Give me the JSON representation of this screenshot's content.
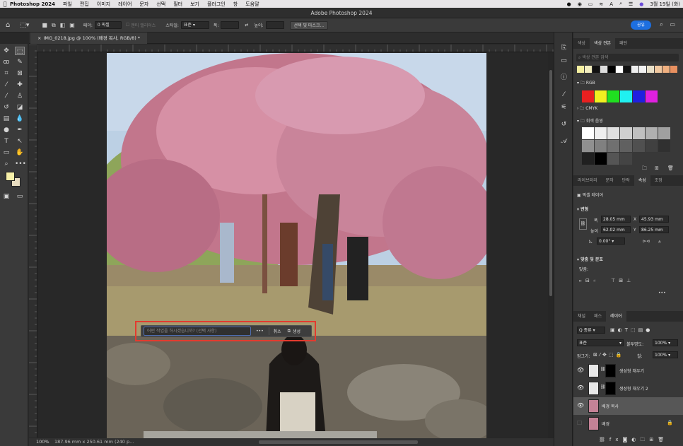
{
  "menubar": {
    "apple": "",
    "app": "Photoshop 2024",
    "items": [
      "파일",
      "편집",
      "이미지",
      "레이어",
      "문자",
      "선택",
      "필터",
      "보기",
      "플러그인",
      "창",
      "도움말"
    ],
    "date": "3월 19일 (화)"
  },
  "window": {
    "title": "Adobe Photoshop 2024"
  },
  "options": {
    "feather_label": "페더:",
    "feather_value": "0 픽셀",
    "antialias": "앤티 앨리어스",
    "style_label": "스타일:",
    "style_value": "표준",
    "width_label": "폭:",
    "height_label": "높이:",
    "select_mask": "선택 및 마스크...",
    "share": "공유"
  },
  "document": {
    "tab": "IMG_0218.jpg @ 100% (배경 복사, RGB/8) *"
  },
  "status": {
    "zoom": "100%",
    "info": "187.96 mm x 250.61 mm (240 p..."
  },
  "generative": {
    "placeholder": "어떤 작업을 하시겠습니까? (선택 사항)",
    "more": "•••",
    "cancel": "취소",
    "generate": "생성"
  },
  "swatches": {
    "tabs": [
      "색상",
      "색상 견본",
      "패턴"
    ],
    "search_placeholder": "색상 견본 검색",
    "recent": [
      "#f5f0a0",
      "#f3eec0",
      "#111111",
      "#dddddd",
      "#000000",
      "#ffffff",
      "#111111",
      "#eeeeee",
      "#f2f2f2",
      "#e8e0c8",
      "#f0c8a0",
      "#f0b080",
      "#e89060"
    ],
    "groups": [
      {
        "name": "RGB",
        "colors": [
          "#e82020",
          "#f0f020",
          "#20e020",
          "#20f0f0",
          "#2020e0",
          "#e020e0"
        ]
      },
      {
        "name": "CMYK"
      },
      {
        "name": "회색 음영",
        "colors": [
          "#ffffff",
          "#eeeeee",
          "#e0e0e0",
          "#d0d0d0",
          "#c0c0c0",
          "#b0b0b0",
          "#a0a0a0",
          "#909090",
          "#808080",
          "#707070",
          "#606060",
          "#505050",
          "#404040",
          "#303030",
          "#202020",
          "#000000",
          "#555555",
          "#444444"
        ]
      }
    ]
  },
  "properties": {
    "tabs": [
      "라이브러리",
      "문자",
      "단락",
      "속성",
      "조정"
    ],
    "layer_kind": "픽셀 레이어",
    "transform": "변형",
    "w_label": "폭",
    "w": "28.05 mm",
    "x_label": "X",
    "x": "45.93 mm",
    "h_label": "높이",
    "h": "62.02 mm",
    "y_label": "Y",
    "y": "86.25 mm",
    "angle": "0.00°",
    "align": "맞춤 및 분포",
    "align_label": "맞춤:",
    "more": "•••"
  },
  "layers": {
    "tabs": [
      "채널",
      "패스",
      "레이어"
    ],
    "kind": "Q 종류",
    "blend": "표준",
    "opacity_label": "불투명도:",
    "opacity": "100%",
    "lock_label": "잠그기:",
    "fill_label": "칠:",
    "fill": "100%",
    "items": [
      {
        "name": "생성형 채우기",
        "selected": false
      },
      {
        "name": "생성형 채우기 2",
        "selected": false
      },
      {
        "name": "배경 복사",
        "selected": true
      },
      {
        "name": "배경",
        "selected": false
      }
    ]
  }
}
